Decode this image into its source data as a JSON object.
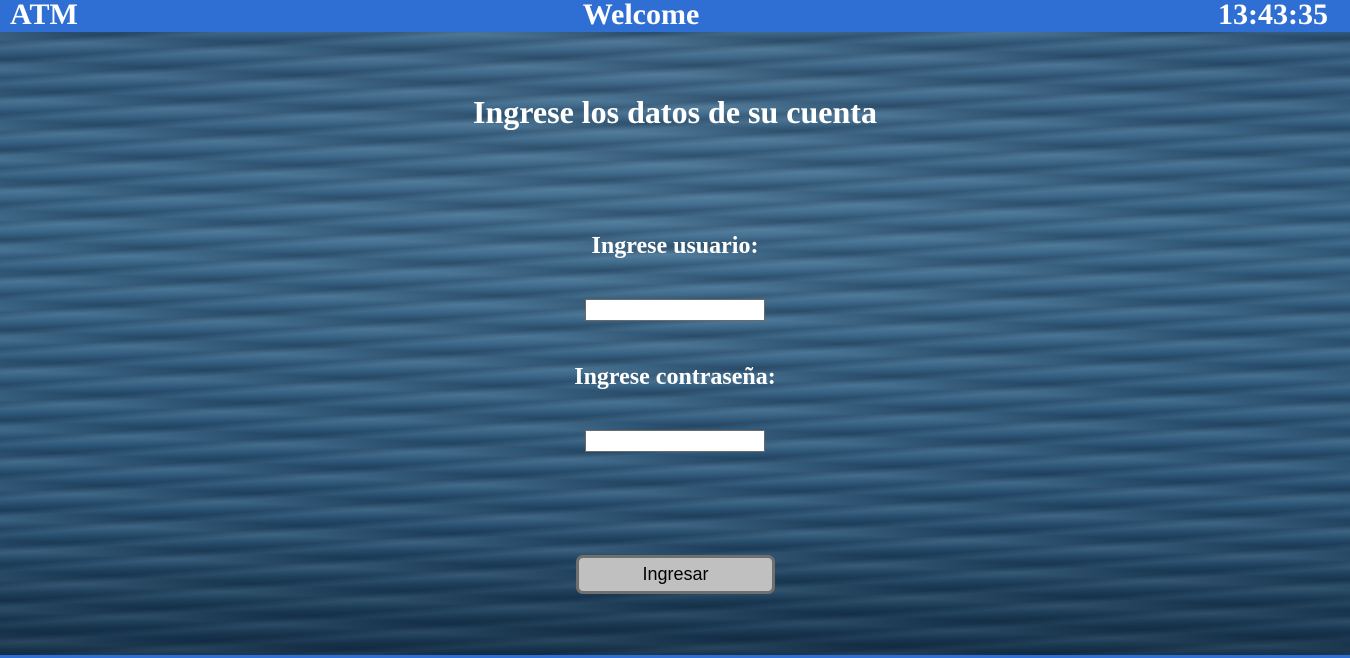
{
  "header": {
    "app_name": "ATM",
    "title": "Welcome",
    "clock": "13:43:35",
    "bar_color": "#2f6fd3"
  },
  "main": {
    "heading": "Ingrese los datos de su cuenta",
    "user_label": "Ingrese usuario:",
    "user_value": "",
    "password_label": "Ingrese contraseña:",
    "password_value": "",
    "submit_label": "Ingresar"
  }
}
